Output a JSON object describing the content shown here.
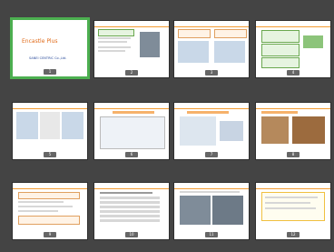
{
  "slides": [
    {
      "number": "1",
      "title": "",
      "cover_title": "Encastle Plus",
      "cover_subtitle": "",
      "logo_text": "SANEI CENTRIC Co.,Ltd.",
      "selected": true
    },
    {
      "number": "2",
      "title": "",
      "selected": false
    },
    {
      "number": "3",
      "title": "",
      "selected": false
    },
    {
      "number": "4",
      "title": "",
      "selected": false
    },
    {
      "number": "5",
      "title": "",
      "selected": false
    },
    {
      "number": "6",
      "title": "",
      "selected": false
    },
    {
      "number": "7",
      "title": "",
      "selected": false
    },
    {
      "number": "8",
      "title": "",
      "selected": false
    },
    {
      "number": "9",
      "title": "",
      "selected": false
    },
    {
      "number": "10",
      "title": "",
      "selected": false
    },
    {
      "number": "11",
      "title": "",
      "selected": false
    },
    {
      "number": "12",
      "title": "",
      "selected": false
    }
  ]
}
